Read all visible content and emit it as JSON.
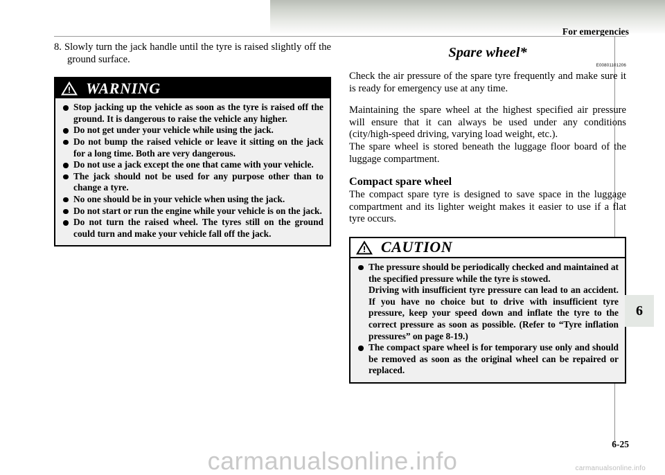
{
  "header": {
    "title": "For emergencies"
  },
  "left_column": {
    "step": "8. Slowly turn the jack handle until the tyre is raised slightly off the ground surface.",
    "warning": {
      "label": "WARNING",
      "icon": "warning-triangle-icon",
      "items": [
        "Stop jacking up the vehicle as soon as the tyre is raised off the ground. It is dangerous to raise the vehicle any higher.",
        "Do not get under your vehicle while using the jack.",
        "Do not bump the raised vehicle or leave it sitting on the jack for a long time. Both are very dangerous.",
        "Do not use a jack except the one that came with your vehicle.",
        "The jack should not be used for any purpose other than to change a tyre.",
        "No one should be in your vehicle when using the jack.",
        "Do not start or run the engine while your vehicle is on the jack.",
        "Do not turn the raised wheel. The tyres still on the ground could turn and make your vehicle fall off the jack."
      ]
    }
  },
  "right_column": {
    "section_title": "Spare wheel*",
    "section_code": "E00801101206",
    "paragraphs": [
      "Check the air pressure of the spare tyre frequently and make sure it is ready for emergency use at any time.",
      "Maintaining the spare wheel at the highest specified air pressure will ensure that it can always be used under any conditions (city/high-speed driving, varying load weight, etc.).",
      "The spare wheel is stored beneath the luggage floor board of the luggage compartment."
    ],
    "subsection_title": "Compact spare wheel",
    "subsection_paragraph": "The compact spare tyre is designed to save space in the luggage compartment and its lighter weight makes it easier to use if a flat tyre occurs.",
    "caution": {
      "label": "CAUTION",
      "icon": "caution-triangle-icon",
      "items": [
        "The pressure should be periodically checked and maintained at the specified pressure while the tyre is stowed.",
        "Driving with insufficient tyre pressure can lead to an accident. If you have no choice but to drive with insufficient tyre pressure, keep your speed down and inflate the tyre to the correct pressure as soon as possible. (Refer to “Tyre inflation pressures” on page 8-19.)",
        "The compact spare wheel is for temporary use only and should be removed as soon as the original wheel can be repaired or replaced."
      ]
    }
  },
  "chapter_tab": {
    "number": "6"
  },
  "footer": {
    "page_number": "6-25",
    "watermark": "carmanualsonline.info",
    "watermark_small": "carmanualsonline.info"
  },
  "colors": {
    "warning_header_bg": "#000000",
    "warning_header_text": "#ffffff",
    "caution_header_bg": "#ffffff",
    "caution_header_text": "#000000",
    "alert_body_bg": "#f0f0f0",
    "tab_bg": "#e4e8e4",
    "watermark": "#c9c9c9"
  }
}
